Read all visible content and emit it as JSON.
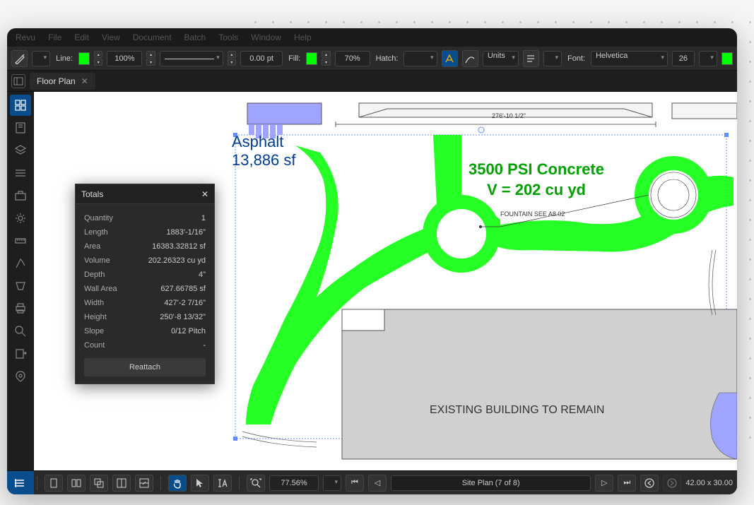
{
  "menu": [
    "Revu",
    "File",
    "Edit",
    "View",
    "Document",
    "Batch",
    "Tools",
    "Window",
    "Help"
  ],
  "toolbar": {
    "line_label": "Line:",
    "zoom_value": "100%",
    "pt_value": "0.00 pt",
    "fill_label": "Fill:",
    "opacity_value": "70%",
    "hatch_label": "Hatch:",
    "units_label": "Units",
    "font_label": "Font:",
    "font_value": "Helvetica",
    "font_size": "26"
  },
  "tab": {
    "title": "Floor Plan"
  },
  "totals": {
    "title": "Totals",
    "rows": [
      {
        "label": "Quantity",
        "value": "1"
      },
      {
        "label": "Length",
        "value": "1883'-1/16\""
      },
      {
        "label": "Area",
        "value": "16383.32812 sf"
      },
      {
        "label": "Volume",
        "value": "202.26323 cu yd"
      },
      {
        "label": "Depth",
        "value": "4\""
      },
      {
        "label": "Wall Area",
        "value": "627.66785 sf"
      },
      {
        "label": "Width",
        "value": "427'-2 7/16\""
      },
      {
        "label": "Height",
        "value": "250'-8 13/32\""
      },
      {
        "label": "Slope",
        "value": "0/12 Pitch"
      },
      {
        "label": "Count",
        "value": "-"
      }
    ],
    "reattach": "Reattach"
  },
  "canvas": {
    "asphalt_line1": "Asphalt",
    "asphalt_line2": "13,886 sf",
    "concrete_line1": "3500 PSI Concrete",
    "concrete_line2": "V = 202 cu yd",
    "building": "EXISTING BUILDING TO REMAIN",
    "fountain": "FOUNTAIN SEE A8.02",
    "dimension": "276'-10 1/2\""
  },
  "bottom": {
    "zoom": "77.56%",
    "page": "Site Plan (7 of 8)",
    "coords": "42.00 x 30.00"
  }
}
